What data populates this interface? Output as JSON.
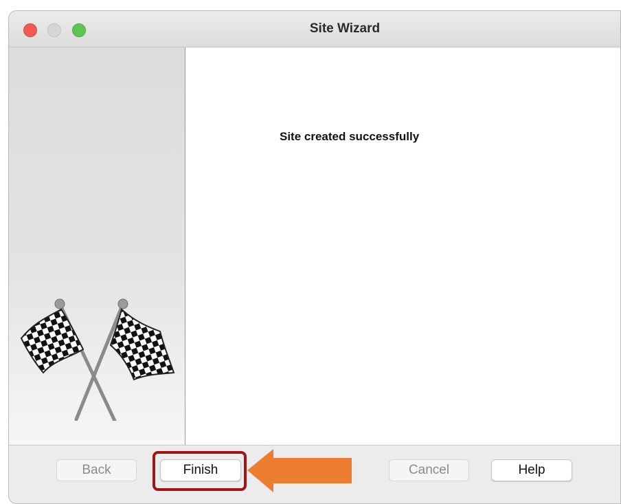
{
  "window": {
    "title": "Site Wizard"
  },
  "content": {
    "message": "Site created successfully"
  },
  "buttons": {
    "back": "Back",
    "finish": "Finish",
    "cancel": "Cancel",
    "help": "Help"
  },
  "icons": {
    "side_graphic": "checkered-flags-icon",
    "annotation": "arrow-left-icon"
  },
  "colors": {
    "close": "#ee5c56",
    "zoom": "#5fc453",
    "highlight": "#a11515",
    "arrow": "#ed7d31"
  }
}
